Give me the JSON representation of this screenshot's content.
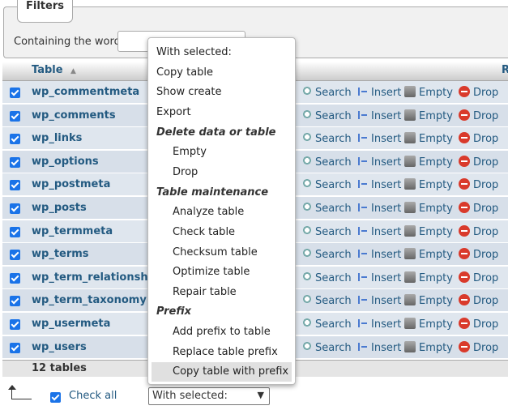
{
  "filters": {
    "legend": "Filters",
    "label": "Containing the word:",
    "input_value": ""
  },
  "table": {
    "header_label": "Table",
    "sort_indicator": "▲",
    "header_right": "R",
    "rows": [
      "wp_commentmeta",
      "wp_comments",
      "wp_links",
      "wp_options",
      "wp_postmeta",
      "wp_posts",
      "wp_termmeta",
      "wp_terms",
      "wp_term_relationships",
      "wp_term_taxonomy",
      "wp_usermeta",
      "wp_users"
    ],
    "actions": {
      "search": "Search",
      "insert": "Insert",
      "empty": "Empty",
      "drop": "Drop"
    },
    "footer": "12 tables"
  },
  "bottom": {
    "check_all": "Check all",
    "select_value": "With selected:"
  },
  "menu": {
    "items": [
      {
        "label": "With selected:",
        "type": "item"
      },
      {
        "label": "Copy table",
        "type": "item"
      },
      {
        "label": "Show create",
        "type": "item"
      },
      {
        "label": "Export",
        "type": "item"
      },
      {
        "label": "Delete data or table",
        "type": "group"
      },
      {
        "label": "Empty",
        "type": "sub"
      },
      {
        "label": "Drop",
        "type": "sub"
      },
      {
        "label": "Table maintenance",
        "type": "group"
      },
      {
        "label": "Analyze table",
        "type": "sub"
      },
      {
        "label": "Check table",
        "type": "sub"
      },
      {
        "label": "Checksum table",
        "type": "sub"
      },
      {
        "label": "Optimize table",
        "type": "sub"
      },
      {
        "label": "Repair table",
        "type": "sub"
      },
      {
        "label": "Prefix",
        "type": "group"
      },
      {
        "label": "Add prefix to table",
        "type": "sub"
      },
      {
        "label": "Replace table prefix",
        "type": "sub"
      },
      {
        "label": "Copy table with prefix",
        "type": "sub-selected"
      }
    ]
  },
  "colors": {
    "link": "#235a81",
    "checkbox": "#1a73e8",
    "row_bg": "#dfe6ee",
    "drop_icon": "#d93a2b"
  }
}
